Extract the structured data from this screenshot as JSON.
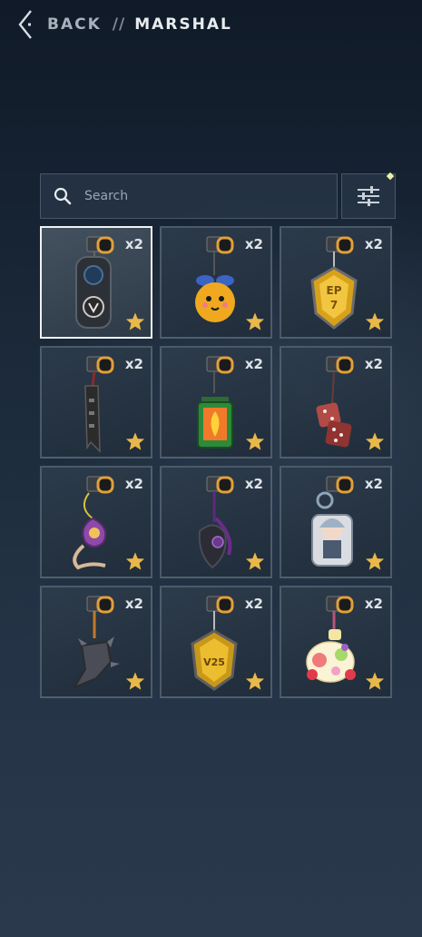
{
  "header": {
    "back_label": "BACK",
    "separator": "//",
    "title": "MARSHAL"
  },
  "search": {
    "placeholder": "Search",
    "value": ""
  },
  "filter": {
    "icon": "sliders-icon"
  },
  "items": [
    {
      "name": "charm-1",
      "count": "x2",
      "selected": true
    },
    {
      "name": "charm-2",
      "count": "x2"
    },
    {
      "name": "charm-3",
      "count": "x2"
    },
    {
      "name": "charm-4",
      "count": "x2"
    },
    {
      "name": "charm-5",
      "count": "x2"
    },
    {
      "name": "charm-6",
      "count": "x2"
    },
    {
      "name": "charm-7",
      "count": "x2"
    },
    {
      "name": "charm-8",
      "count": "x2"
    },
    {
      "name": "charm-9",
      "count": "x2"
    },
    {
      "name": "charm-10",
      "count": "x2"
    },
    {
      "name": "charm-11",
      "count": "x2"
    },
    {
      "name": "charm-12",
      "count": "x2"
    }
  ],
  "colors": {
    "star": "#e8b84a",
    "selected_border": "#eef2f5",
    "accent": "#f1f0a8"
  }
}
